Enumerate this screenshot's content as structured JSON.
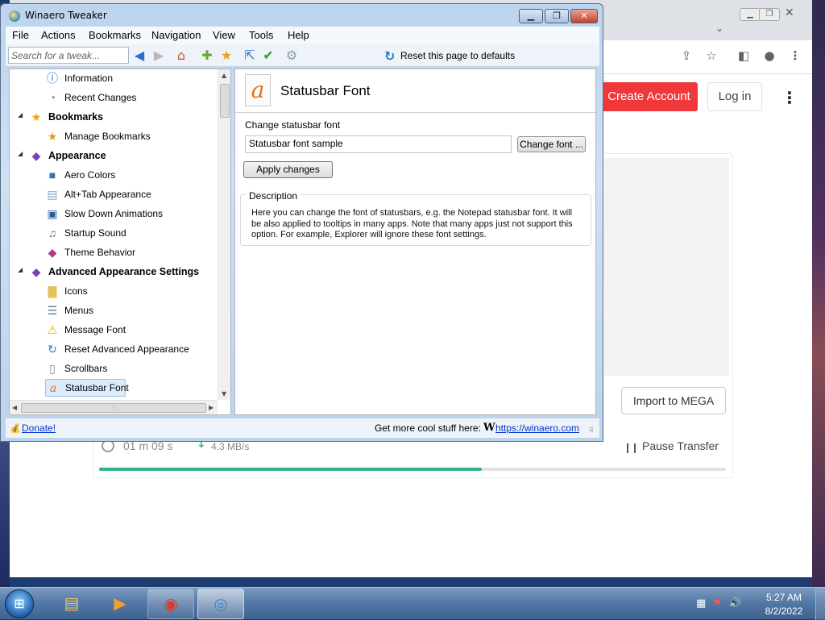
{
  "browser": {
    "create_account": "Create Account",
    "log_in": "Log in",
    "import_button": "Import to MEGA",
    "elapsed_time": "01 m 09 s",
    "speed": "4.3 MB/s",
    "pause": "Pause Transfer",
    "progress": 0.61,
    "accent_color": "#f0373a",
    "progress_color": "#2db584"
  },
  "tweaker": {
    "title": "Winaero Tweaker",
    "menu": [
      "File",
      "Actions",
      "Bookmarks",
      "Navigation",
      "View",
      "Tools",
      "Help"
    ],
    "search_placeholder": "Search for a tweak...",
    "reset_label": "Reset this page to defaults",
    "tree": [
      {
        "label": "Information",
        "icon": "info-icon"
      },
      {
        "label": "Recent Changes",
        "icon": "recent-changes-icon"
      },
      {
        "label": "Bookmarks",
        "icon": "star-icon"
      },
      {
        "label": "Manage Bookmarks",
        "icon": "star-gear-icon"
      },
      {
        "label": "Appearance",
        "icon": "palette-icon"
      },
      {
        "label": "Aero Colors",
        "icon": "aero-colors-icon"
      },
      {
        "label": "Alt+Tab Appearance",
        "icon": "alt-tab-icon"
      },
      {
        "label": "Slow Down Animations",
        "icon": "monitor-icon"
      },
      {
        "label": "Startup Sound",
        "icon": "speaker-icon"
      },
      {
        "label": "Theme Behavior",
        "icon": "theme-icon"
      },
      {
        "label": "Advanced Appearance Settings",
        "icon": "palette-icon"
      },
      {
        "label": "Icons",
        "icon": "folder-icon"
      },
      {
        "label": "Menus",
        "icon": "menu-icon"
      },
      {
        "label": "Message Font",
        "icon": "warning-icon"
      },
      {
        "label": "Reset Advanced Appearance",
        "icon": "reset-icon"
      },
      {
        "label": "Scrollbars",
        "icon": "scrollbar-icon"
      },
      {
        "label": "Statusbar Font",
        "icon": "font-icon"
      }
    ],
    "panel": {
      "title": "Statusbar Font",
      "change_label": "Change statusbar font",
      "sample_value": "Statusbar font sample",
      "change_font_button": "Change font ...",
      "apply_button": "Apply changes",
      "description_legend": "Description",
      "description_text": "Here you can change the font of statusbars, e.g. the Notepad statusbar font. It will be also applied to tooltips in many apps. Note that many apps just not support this option. For example, Explorer will ignore these font settings."
    },
    "status": {
      "donate": "Donate!",
      "cool_stuff": "Get more cool stuff here:",
      "site": "https://winaero.com"
    }
  },
  "taskbar": {
    "time": "5:27 AM",
    "date": "8/2/2022"
  }
}
